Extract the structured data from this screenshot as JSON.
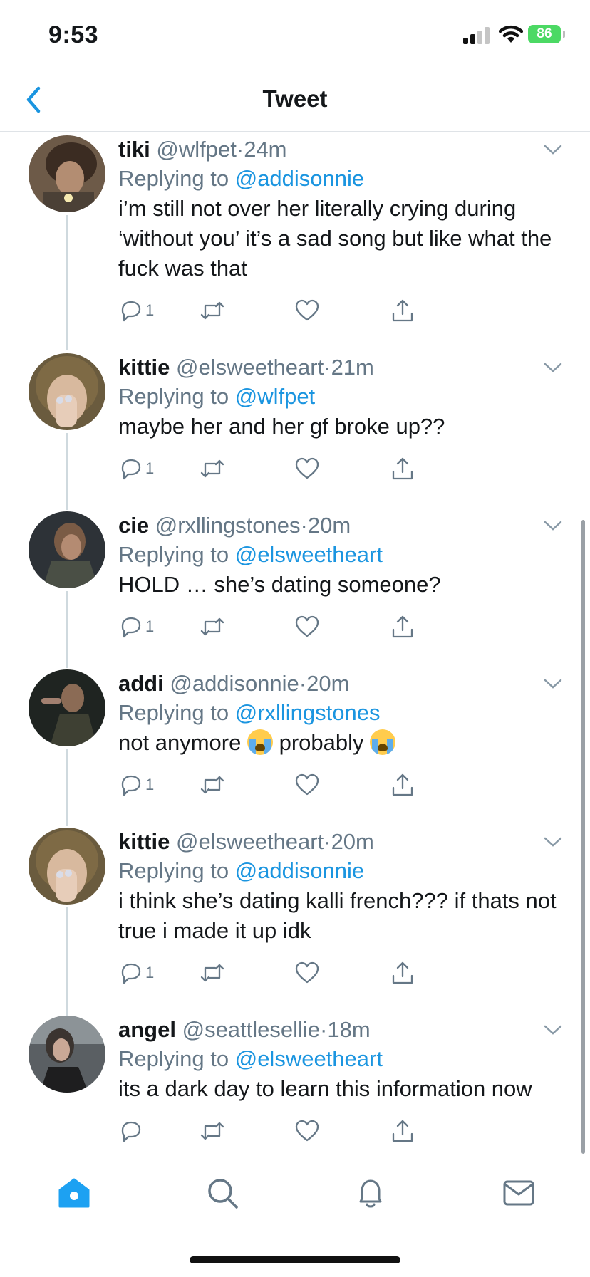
{
  "status_bar": {
    "time": "9:53",
    "battery": "86"
  },
  "nav": {
    "title": "Tweet"
  },
  "replying_to_prefix": "Replying to",
  "tweets": [
    {
      "name": "tiki",
      "handle": "@wlfpet",
      "sep": "·",
      "time": "24m",
      "replying_to": "@addisonnie",
      "text": "i’m still not over her literally crying during ‘without you’ it’s a sad song but like what the fuck was that",
      "reply_count": "1"
    },
    {
      "name": "kittie",
      "handle": "@elsweetheart",
      "sep": "·",
      "time": "21m",
      "replying_to": "@wlfpet",
      "text": "maybe her and her gf broke up??",
      "reply_count": "1"
    },
    {
      "name": "cie",
      "handle": "@rxllingstones",
      "sep": "·",
      "time": "20m",
      "replying_to": "@elsweetheart",
      "text": "HOLD … she’s dating someone?",
      "reply_count": "1"
    },
    {
      "name": "addi",
      "handle": "@addisonnie",
      "sep": "·",
      "time": "20m",
      "replying_to": "@rxllingstones",
      "text_a": "not anymore",
      "text_b": "probably",
      "reply_count": "1"
    },
    {
      "name": "kittie",
      "handle": "@elsweetheart",
      "sep": "·",
      "time": "20m",
      "replying_to": "@addisonnie",
      "text": "i think she’s dating kalli french??? if thats not true i made it up idk",
      "reply_count": "1"
    },
    {
      "name": "angel",
      "handle": "@seattlesellie",
      "sep": "·",
      "time": "18m",
      "replying_to": "@elsweetheart",
      "text": "its a dark day to learn this information now",
      "reply_count": ""
    }
  ],
  "colors": {
    "accent": "#1b95e0",
    "muted": "#657786",
    "battery": "#4cd964"
  },
  "icons": [
    "back-chevron",
    "reply",
    "retweet",
    "like",
    "share",
    "home",
    "search",
    "notifications",
    "messages"
  ]
}
